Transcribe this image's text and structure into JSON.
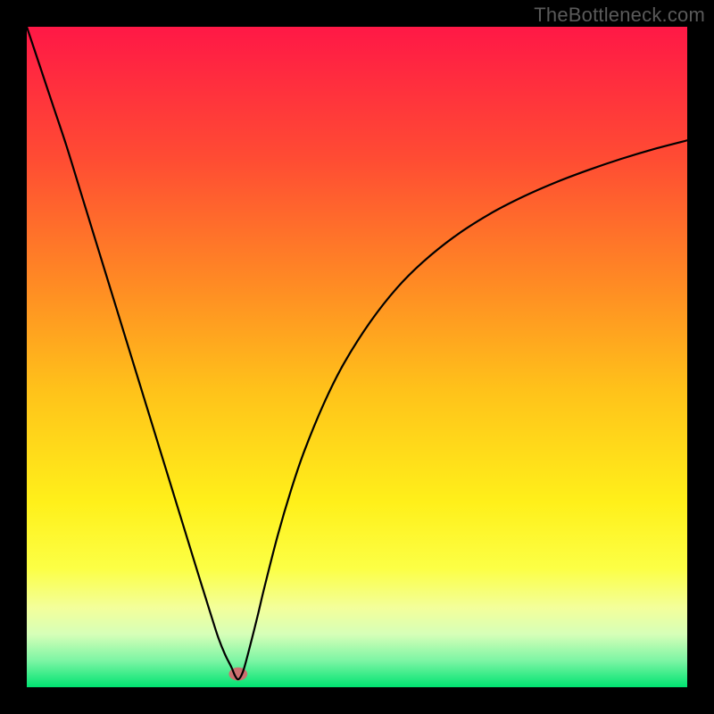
{
  "watermark": {
    "text": "TheBottleneck.com"
  },
  "chart_data": {
    "type": "line",
    "title": "",
    "xlabel": "",
    "ylabel": "",
    "xlim": [
      0,
      100
    ],
    "ylim": [
      0,
      100
    ],
    "background": {
      "type": "vertical-gradient",
      "stops": [
        {
          "offset": 0.0,
          "color": "#ff1846"
        },
        {
          "offset": 0.2,
          "color": "#ff4c33"
        },
        {
          "offset": 0.4,
          "color": "#ff8e23"
        },
        {
          "offset": 0.55,
          "color": "#ffc21a"
        },
        {
          "offset": 0.72,
          "color": "#fff01a"
        },
        {
          "offset": 0.82,
          "color": "#fcff45"
        },
        {
          "offset": 0.88,
          "color": "#f3ff9b"
        },
        {
          "offset": 0.92,
          "color": "#d6ffb8"
        },
        {
          "offset": 0.96,
          "color": "#7cf5a4"
        },
        {
          "offset": 1.0,
          "color": "#00e371"
        }
      ]
    },
    "annotations": [
      {
        "type": "oval",
        "x": 32,
        "y": 2,
        "rx": 1.4,
        "ry": 1.0,
        "fill": "#cc6f70"
      }
    ],
    "series": [
      {
        "name": "bottleneck-curve",
        "color": "#000000",
        "stroke_width": 2.2,
        "x": [
          0,
          2,
          4,
          6,
          8,
          10,
          12,
          14,
          16,
          18,
          20,
          22,
          24,
          26,
          27,
          28,
          29,
          30,
          31,
          31.5,
          32,
          32.5,
          33,
          34,
          35,
          36,
          38,
          40,
          42,
          45,
          48,
          52,
          56,
          60,
          65,
          70,
          75,
          80,
          85,
          90,
          95,
          100
        ],
        "y": [
          100,
          94,
          88,
          82,
          75.5,
          69,
          62.5,
          56,
          49.5,
          43,
          36.5,
          30,
          23.5,
          17,
          13.8,
          10.6,
          7.5,
          5.0,
          3.0,
          1.8,
          1.2,
          1.8,
          3.2,
          7.0,
          11.0,
          15.2,
          23.0,
          29.8,
          35.7,
          43.0,
          49.0,
          55.3,
          60.4,
          64.4,
          68.4,
          71.6,
          74.2,
          76.4,
          78.3,
          80.0,
          81.5,
          82.8
        ]
      }
    ],
    "minimum": {
      "x": 32,
      "y": 1.2
    }
  }
}
